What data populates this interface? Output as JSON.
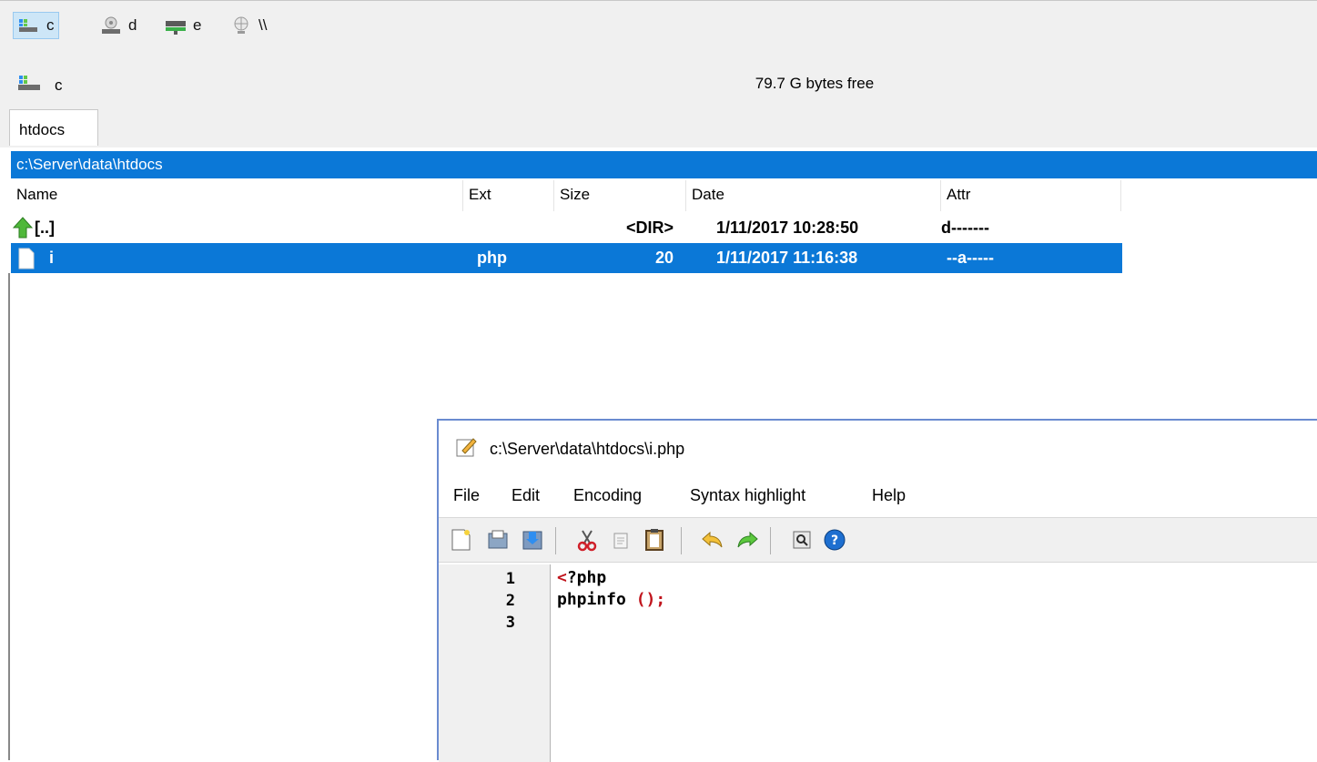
{
  "drives": [
    {
      "label": "c",
      "icon": "hard-drive-icon",
      "active": true
    },
    {
      "label": "d",
      "icon": "optical-drive-icon",
      "active": false
    },
    {
      "label": "e",
      "icon": "network-drive-icon",
      "active": false
    },
    {
      "label": "\\\\",
      "icon": "network-share-icon",
      "active": false
    }
  ],
  "current_drive": {
    "label": "c",
    "free_space": "79.7 G bytes free"
  },
  "tab": {
    "label": "htdocs"
  },
  "path": "c:\\Server\\data\\htdocs",
  "columns": {
    "name": "Name",
    "ext": "Ext",
    "size": "Size",
    "date": "Date",
    "attr": "Attr"
  },
  "files": [
    {
      "name": "[..]",
      "ext": "",
      "size": "<DIR>",
      "date": "1/11/2017 10:28:50",
      "attr": "d-------",
      "icon": "up-arrow-icon"
    },
    {
      "name": "i",
      "ext": "php",
      "size": "20",
      "date": "1/11/2017 11:16:38",
      "attr": "--a-----",
      "icon": "file-icon"
    }
  ],
  "editor": {
    "title": "c:\\Server\\data\\htdocs\\i.php",
    "menu": [
      "File",
      "Edit",
      "Encoding",
      "Syntax highlight",
      "Help"
    ],
    "toolbar": [
      "new-file-icon",
      "open-icon",
      "save-icon",
      "cut-icon",
      "copy-icon",
      "paste-icon",
      "undo-icon",
      "redo-icon",
      "find-icon",
      "help-icon"
    ],
    "line_numbers": [
      "1",
      "2",
      "3"
    ],
    "code": {
      "line1_open": "<",
      "line1_rest": "?php",
      "line2_func": "phpinfo ",
      "line2_parens": "();"
    }
  },
  "colors": {
    "selection": "#0b78d7",
    "code_accent": "#c0141c"
  }
}
